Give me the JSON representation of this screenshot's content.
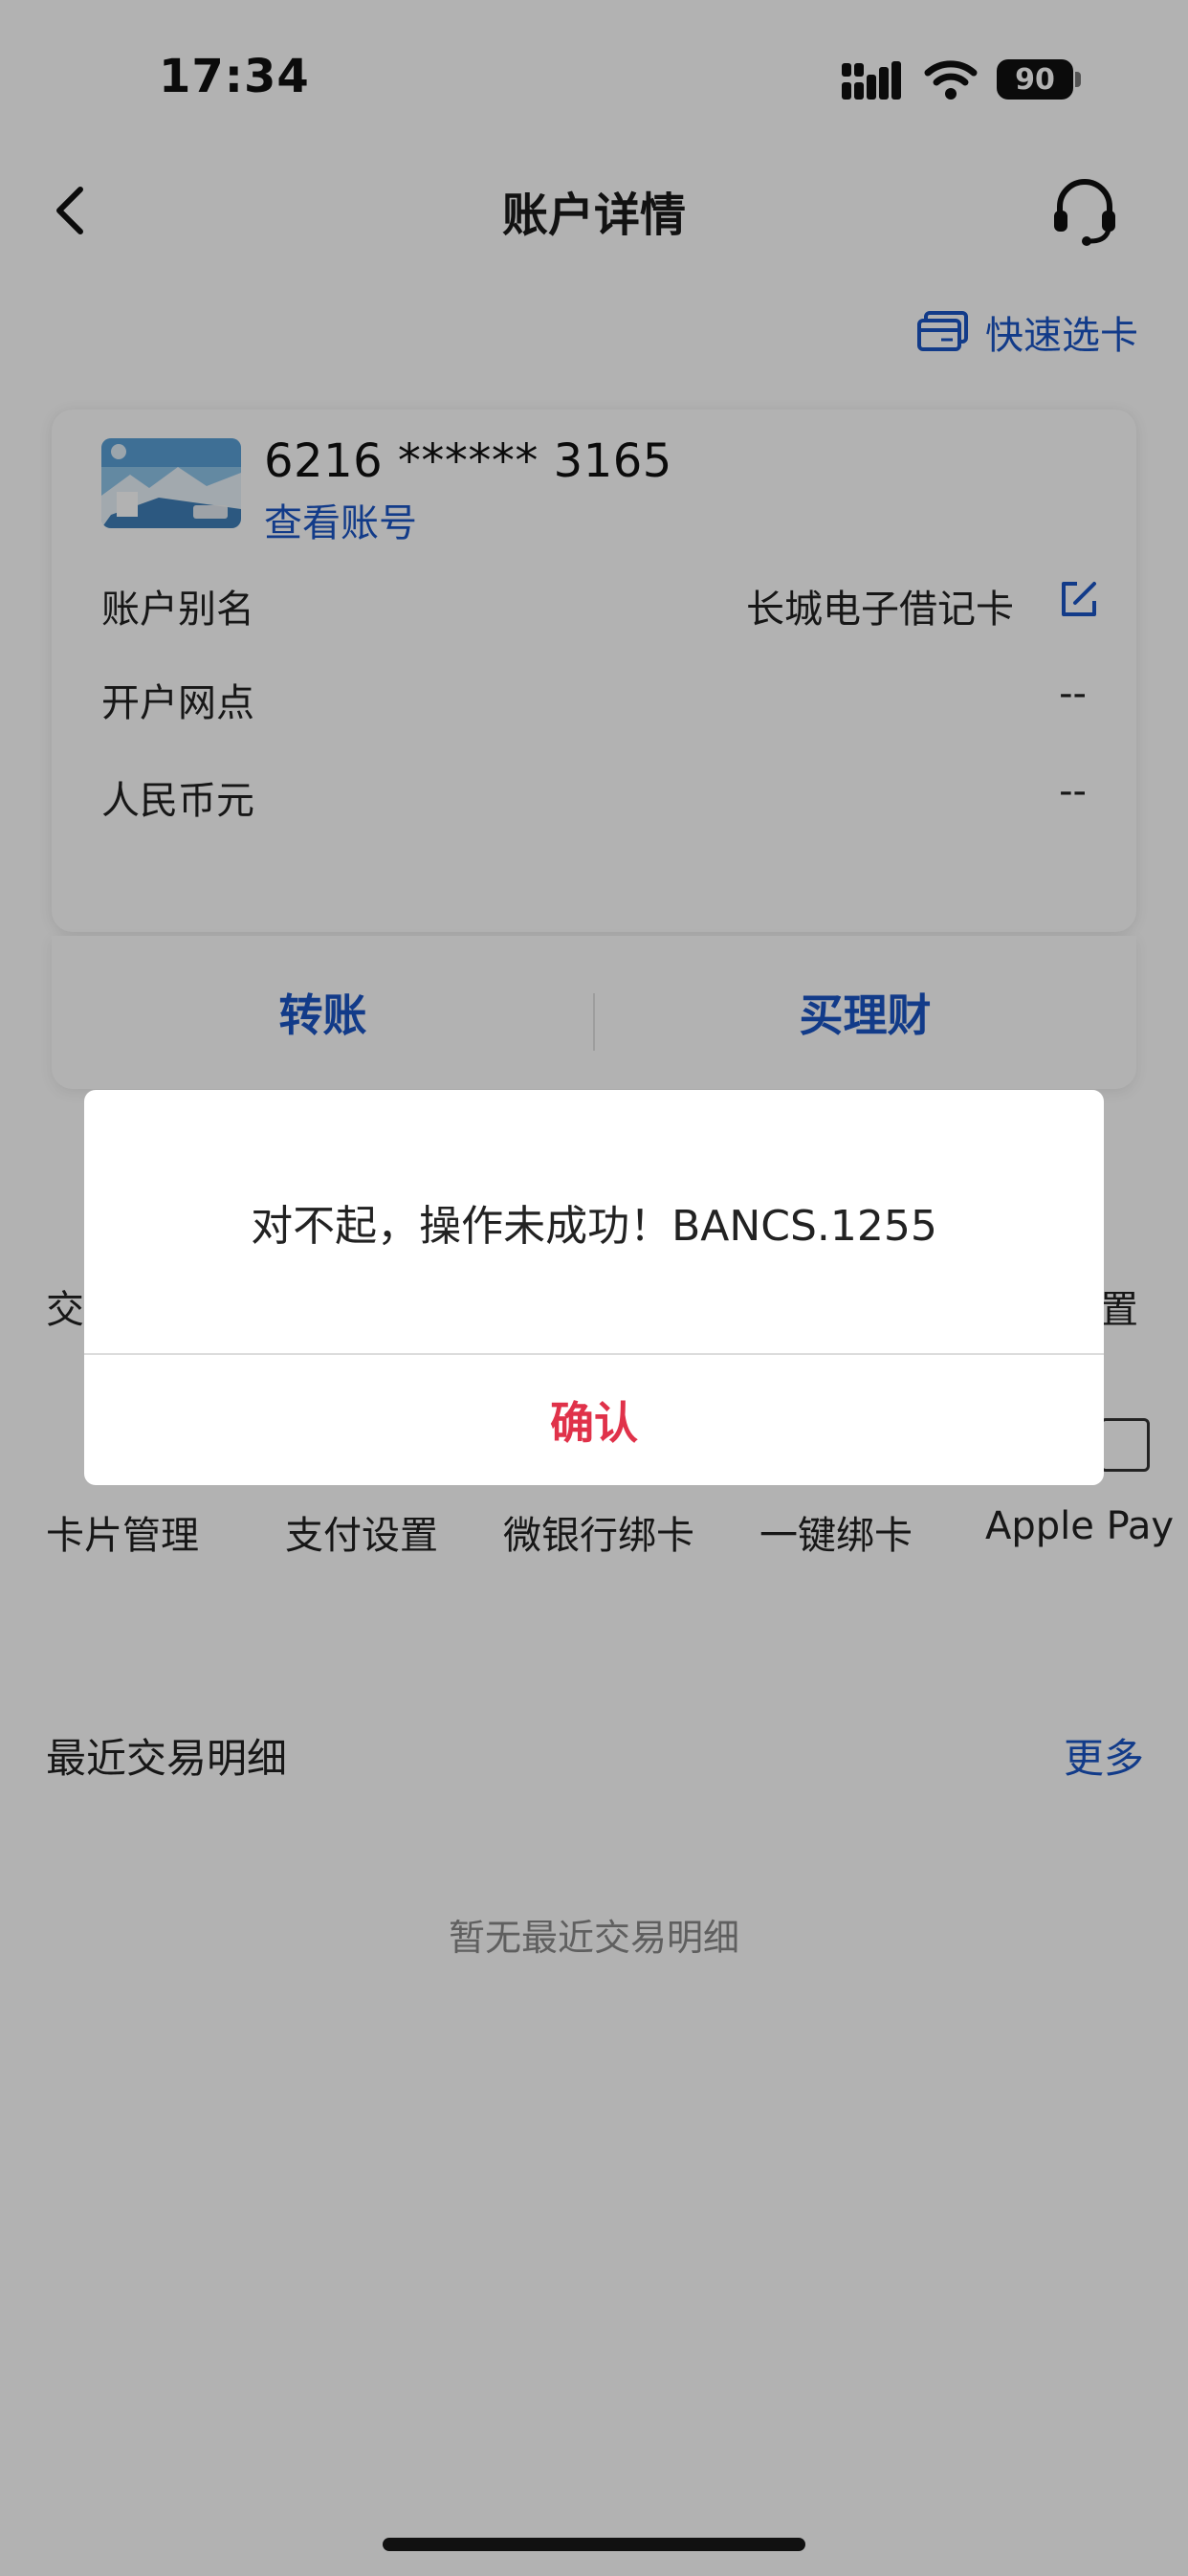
{
  "status_bar": {
    "time": "17:34",
    "battery": "90",
    "icons": [
      "signal-icon",
      "wifi-icon",
      "battery-icon"
    ]
  },
  "nav": {
    "title": "账户详情",
    "back_icon": "chevron-left-icon",
    "service_icon": "headset-icon"
  },
  "quick_select": {
    "label": "快速选卡",
    "icon": "card-icon"
  },
  "account_card": {
    "card_number": "6216 ****** 3165",
    "view_account": "查看账号",
    "rows": [
      {
        "label": "账户别名",
        "value": "长城电子借记卡"
      },
      {
        "label": "开户网点",
        "value": "--"
      },
      {
        "label": "人民币元",
        "value": "--"
      }
    ]
  },
  "actions": {
    "transfer": "转账",
    "wealth": "买理财"
  },
  "functions": {
    "top_row_left_partial": "交",
    "top_row_right_partial": "置",
    "items": [
      "卡片管理",
      "支付设置",
      "微银行绑卡",
      "一键绑卡",
      "Apple Pay"
    ]
  },
  "recent": {
    "title": "最近交易明细",
    "more": "更多",
    "empty": "暂无最近交易明细"
  },
  "dialog": {
    "message": "对不起，操作未成功！BANCS.1255",
    "confirm": "确认"
  },
  "colors": {
    "accent_blue": "#1a55c4",
    "confirm_red": "#e0324a",
    "overlay": "rgba(0,0,0,0.30)"
  }
}
